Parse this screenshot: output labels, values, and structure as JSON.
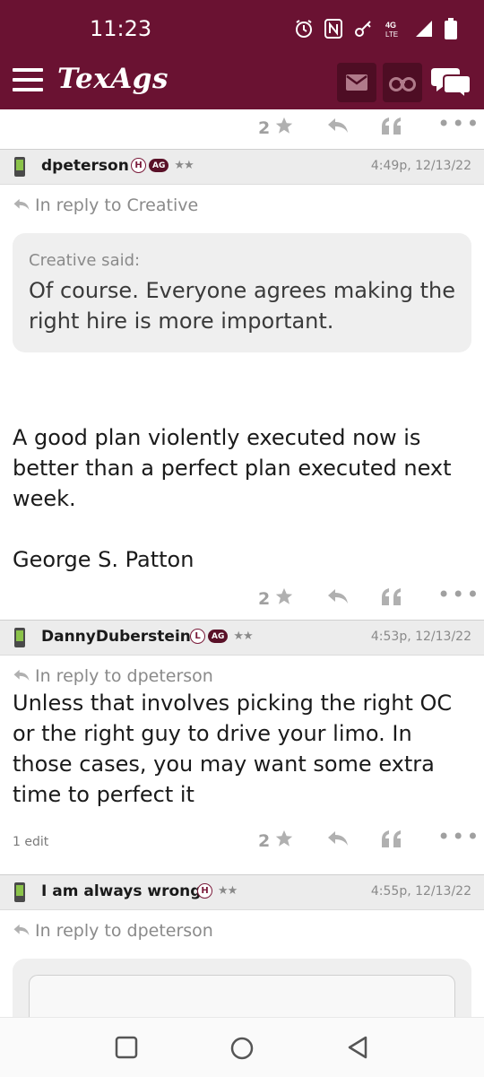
{
  "status_bar": {
    "time": "11:23",
    "network": "4G LTE"
  },
  "header": {
    "app_name": "TexAgs"
  },
  "top_actions": {
    "star_count": "2"
  },
  "posts": [
    {
      "username": "dpeterson",
      "badges": [
        "H",
        "AG"
      ],
      "rank": "★★",
      "timestamp": "4:49p, 12/13/22",
      "reply_to": "In reply to Creative",
      "quote": {
        "author": "Creative said:",
        "text": "Of course. Everyone agrees making the right hire is more important."
      },
      "body_1": "A good plan violently executed now is better than a perfect plan executed next week.",
      "body_2": "George S. Patton",
      "star_count": "2"
    },
    {
      "username": "DannyDuberstein",
      "badges": [
        "L",
        "AG"
      ],
      "rank": "★★",
      "timestamp": "4:53p, 12/13/22",
      "reply_to": "In reply to dpeterson",
      "body": "Unless that involves picking the right OC or the right guy to drive your limo. In those cases, you may want some extra time to perfect it",
      "edit_note": "1 edit",
      "star_count": "2"
    },
    {
      "username": "I am always wrong",
      "badges": [
        "H"
      ],
      "rank": "★★",
      "timestamp": "4:55p, 12/13/22",
      "reply_to": "In reply to dpeterson"
    }
  ],
  "colors": {
    "brand": "#6a1232",
    "brand_dark": "#4e0d24",
    "muted": "#8a8a8a"
  },
  "icons": [
    "menu-icon",
    "mail-icon",
    "binoculars-icon",
    "chat-icon",
    "star-icon",
    "reply-icon",
    "quote-icon",
    "more-icon",
    "phone-icon",
    "square-nav-icon",
    "circle-nav-icon",
    "back-nav-icon"
  ]
}
